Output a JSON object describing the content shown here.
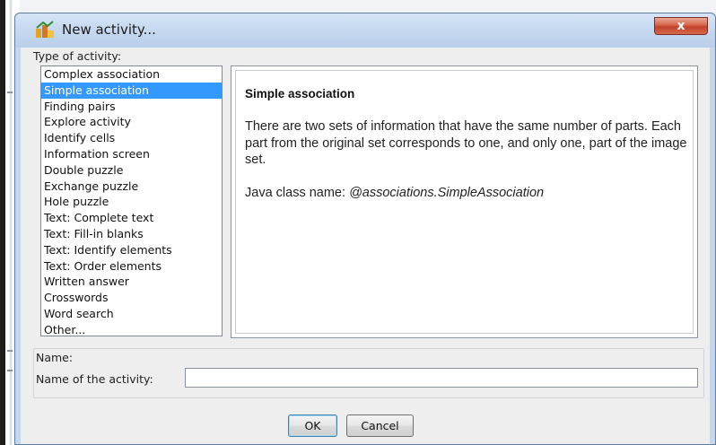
{
  "dialog": {
    "title": "New activity...",
    "close_glyph": "x",
    "type_label": "Type of activity:",
    "activity_types": [
      "Complex association",
      "Simple association",
      "Finding pairs",
      "Explore activity",
      "Identify cells",
      "Information screen",
      "Double puzzle",
      "Exchange puzzle",
      "Hole puzzle",
      "Text: Complete text",
      "Text: Fill-in blanks",
      "Text: Identify elements",
      "Text: Order elements",
      "Written answer",
      "Crosswords",
      "Word search",
      "Other..."
    ],
    "selected_type": "Simple association",
    "description": {
      "title": "Simple association",
      "body": "There are two sets of information that have the same number of parts. Each part from the original set corresponds to one, and only one, part of the image set.",
      "class_prefix": "Java class name: ",
      "class_name": "@associations.SimpleAssociation"
    },
    "name_section": {
      "label": "Name:",
      "field_label": "Name of the activity:",
      "field_value": ""
    },
    "buttons": {
      "ok": "OK",
      "cancel": "Cancel"
    }
  },
  "icons": {
    "app": "app-activity-icon",
    "close": "close-icon"
  },
  "colors": {
    "selection": "#3399ff",
    "close_button": "#c4412a",
    "titlebar": "#c5d8ef"
  }
}
